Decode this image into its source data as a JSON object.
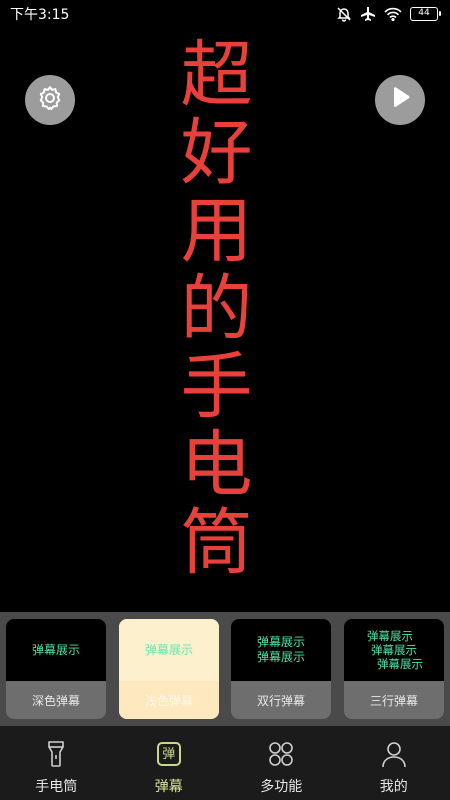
{
  "status_bar": {
    "time": "下午3:15",
    "battery": "44"
  },
  "danmaku": {
    "text": "超好用的手电筒",
    "color": "#e8403a"
  },
  "styles": {
    "preview_text": "弹幕展示",
    "cards": [
      {
        "label": "深色弹幕"
      },
      {
        "label": "浅色弹幕"
      },
      {
        "label": "双行弹幕"
      },
      {
        "label": "三行弹幕"
      }
    ]
  },
  "nav": {
    "items": [
      {
        "label": "手电筒",
        "icon": "flashlight-icon"
      },
      {
        "label": "弹幕",
        "icon": "bullet-comment-icon",
        "glyph": "弹"
      },
      {
        "label": "多功能",
        "icon": "grid-icon"
      },
      {
        "label": "我的",
        "icon": "person-icon"
      }
    ],
    "active_color": "#d6e59a"
  }
}
